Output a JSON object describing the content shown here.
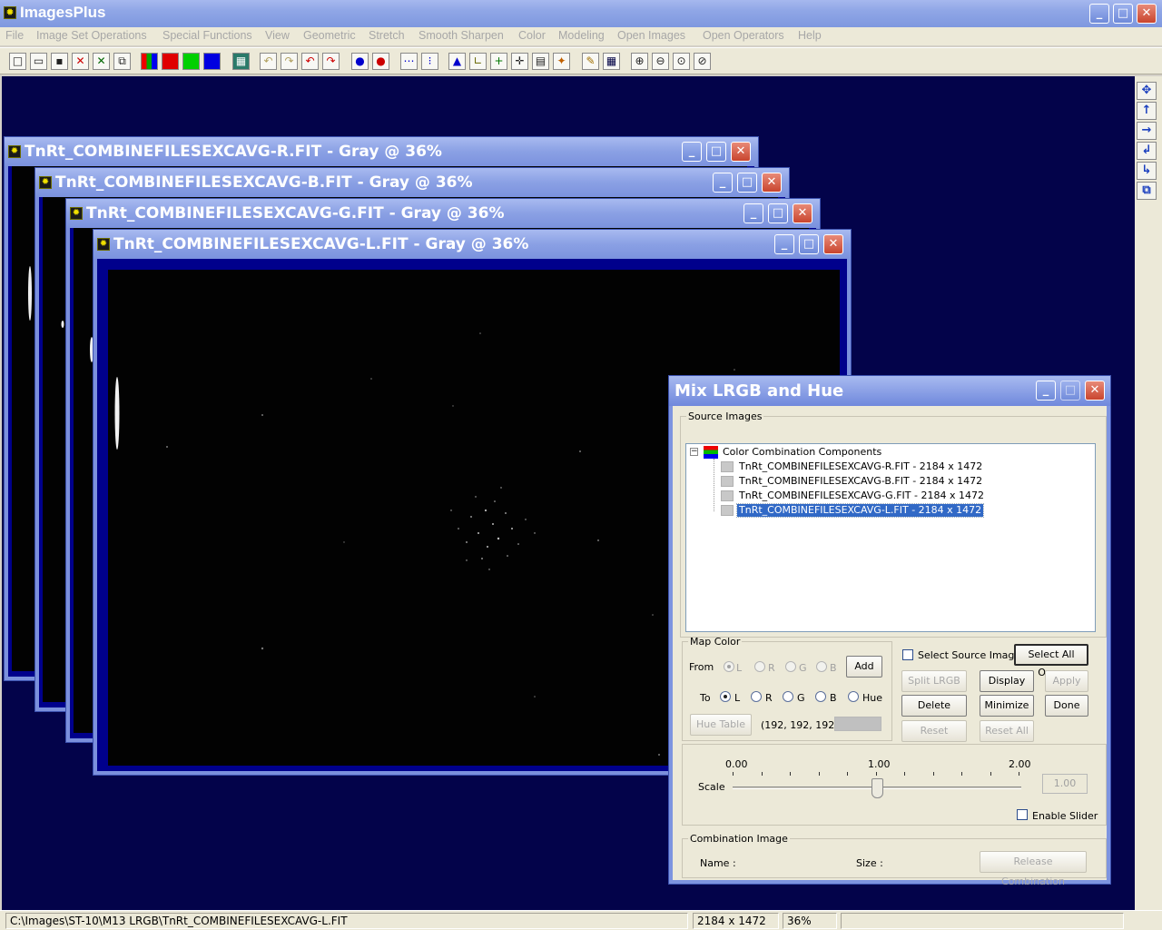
{
  "app": {
    "title": "ImagesPlus"
  },
  "menu": [
    "File",
    "Image Set Operations",
    "Special Functions",
    "View",
    "Geometric",
    "Stretch",
    "Smooth Sharpen",
    "Color",
    "Modeling",
    "Open Images",
    "Open Operators",
    "Help"
  ],
  "windows": [
    {
      "title": "TnRt_COMBINEFILESEXCAVG-R.FIT - Gray @ 36%"
    },
    {
      "title": "TnRt_COMBINEFILESEXCAVG-B.FIT - Gray @ 36%"
    },
    {
      "title": "TnRt_COMBINEFILESEXCAVG-G.FIT - Gray @ 36%"
    },
    {
      "title": "TnRt_COMBINEFILESEXCAVG-L.FIT - Gray @ 36%"
    }
  ],
  "dialog": {
    "title": "Mix LRGB and Hue",
    "source_group": "Source Images",
    "tree_root": "Color Combination Components",
    "tree_items": [
      "TnRt_COMBINEFILESEXCAVG-R.FIT - 2184 x 1472",
      "TnRt_COMBINEFILESEXCAVG-B.FIT - 2184 x 1472",
      "TnRt_COMBINEFILESEXCAVG-G.FIT - 2184 x 1472",
      "TnRt_COMBINEFILESEXCAVG-L.FIT - 2184 x 1472"
    ],
    "map_color": {
      "legend": "Map Color",
      "from_label": "From",
      "to_label": "To",
      "from_options": [
        "L",
        "R",
        "G",
        "B"
      ],
      "to_options": [
        "L",
        "R",
        "G",
        "B",
        "Hue"
      ],
      "add": "Add",
      "hue_table": "Hue Table",
      "rgb_value": "(192, 192, 192)",
      "swatch_color": "#c0c0c0"
    },
    "select_source_image": "Select Source Image",
    "buttons": {
      "select_all_open": "Select All Open",
      "split_lrgb": "Split LRGB",
      "display": "Display",
      "apply": "Apply",
      "delete": "Delete",
      "minimize": "Minimize",
      "done": "Done",
      "reset": "Reset",
      "reset_all": "Reset All",
      "release_combination": "Release Combination"
    },
    "scale": {
      "label": "Scale",
      "tick_min": "0.00",
      "tick_mid": "1.00",
      "tick_max": "2.00",
      "value": "1.00",
      "position": 0.5,
      "enable_slider": "Enable Slider"
    },
    "combination": {
      "legend": "Combination Image",
      "name_label": "Name :",
      "size_label": "Size :"
    }
  },
  "status": {
    "path": "C:\\Images\\ST-10\\M13 LRGB\\TnRt_COMBINEFILESEXCAVG-L.FIT",
    "dimensions": "2184 x 1472",
    "zoom": "36%"
  }
}
